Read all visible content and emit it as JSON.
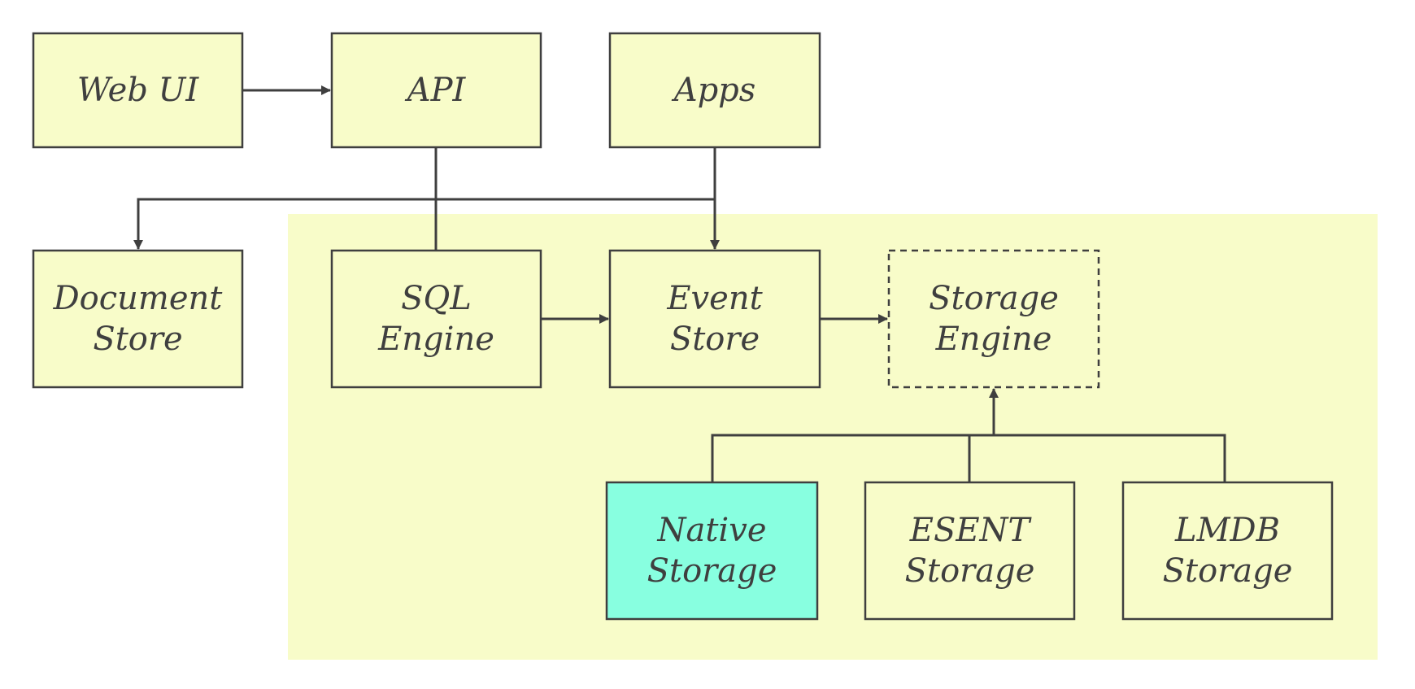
{
  "diagram": {
    "colors": {
      "node_fill": "#f8fcc9",
      "highlight_fill": "#88ffe0",
      "group_fill": "#f8fcc9",
      "stroke": "#3f3f3f",
      "text": "#3f3f3f"
    },
    "nodes": [
      {
        "id": "web-ui",
        "lines": [
          "Web UI"
        ],
        "style": "solid"
      },
      {
        "id": "api",
        "lines": [
          "API"
        ],
        "style": "solid"
      },
      {
        "id": "apps",
        "lines": [
          "Apps"
        ],
        "style": "solid"
      },
      {
        "id": "document-store",
        "lines": [
          "Document",
          "Store"
        ],
        "style": "solid"
      },
      {
        "id": "sql-engine",
        "lines": [
          "SQL",
          "Engine"
        ],
        "style": "solid"
      },
      {
        "id": "event-store",
        "lines": [
          "Event",
          "Store"
        ],
        "style": "solid"
      },
      {
        "id": "storage-engine",
        "lines": [
          "Storage",
          "Engine"
        ],
        "style": "dashed"
      },
      {
        "id": "native-storage",
        "lines": [
          "Native",
          "Storage"
        ],
        "style": "highlight"
      },
      {
        "id": "esent-storage",
        "lines": [
          "ESENT",
          "Storage"
        ],
        "style": "solid"
      },
      {
        "id": "lmdb-storage",
        "lines": [
          "LMDB",
          "Storage"
        ],
        "style": "solid"
      }
    ],
    "edges": [
      {
        "from": "web-ui",
        "to": "api",
        "arrow": true
      },
      {
        "from": "api",
        "to": "sql-engine",
        "arrow": false
      },
      {
        "from": "api",
        "to": "document-store",
        "arrow": true
      },
      {
        "from": "api",
        "to": "event-store",
        "arrow": true
      },
      {
        "from": "apps",
        "to": "event-store",
        "arrow": true
      },
      {
        "from": "apps",
        "to": "document-store",
        "arrow": true
      },
      {
        "from": "sql-engine",
        "to": "event-store",
        "arrow": true
      },
      {
        "from": "event-store",
        "to": "storage-engine",
        "arrow": true
      },
      {
        "from": "native-storage",
        "to": "storage-engine",
        "arrow": true
      },
      {
        "from": "esent-storage",
        "to": "storage-engine",
        "arrow": true
      },
      {
        "from": "lmdb-storage",
        "to": "storage-engine",
        "arrow": true
      }
    ],
    "groups": [
      {
        "id": "core-group",
        "members": [
          "sql-engine",
          "event-store",
          "storage-engine",
          "native-storage",
          "esent-storage",
          "lmdb-storage"
        ]
      }
    ]
  }
}
